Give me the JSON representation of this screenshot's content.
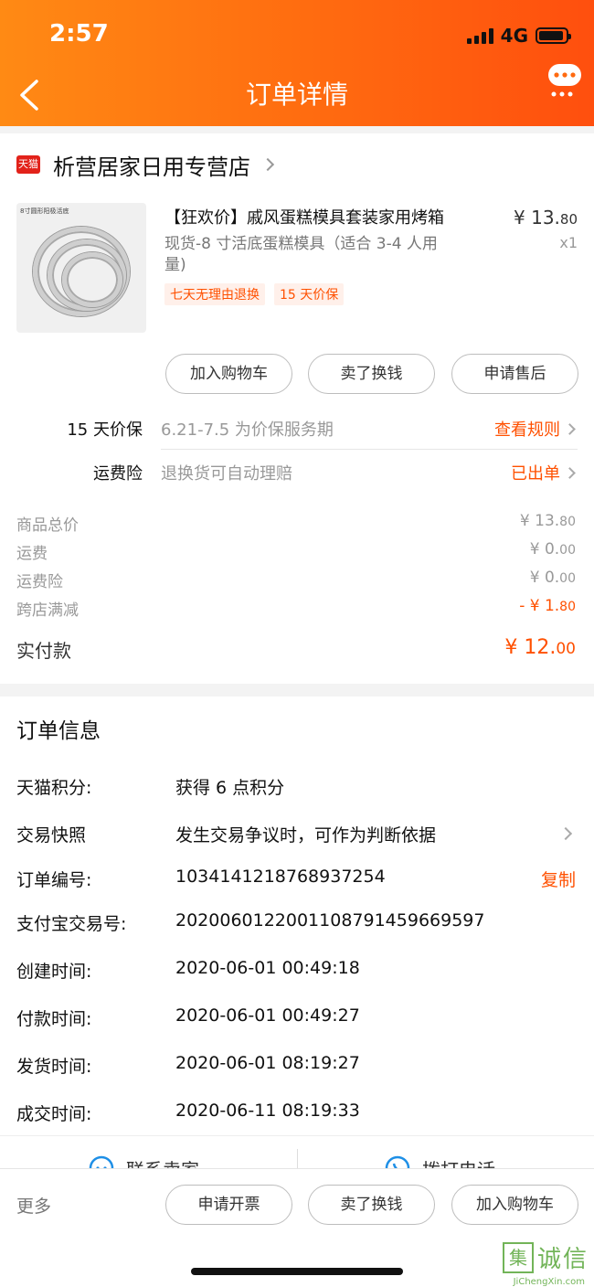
{
  "status_bar": {
    "time": "2:57",
    "network": "4G"
  },
  "header": {
    "title": "订单详情"
  },
  "shop": {
    "badge": "天猫",
    "name": "析营居家日用专营店"
  },
  "product": {
    "image_caption": "8寸圆形阳极活底",
    "title": "【狂欢价】戚风蛋糕模具套装家用烤箱",
    "spec": "现货-8 寸活底蛋糕模具（适合 3-4 人用量)",
    "price_main": "¥ 13.",
    "price_dec": "80",
    "qty": "x1",
    "tags": [
      "七天无理由退换",
      "15 天价保"
    ]
  },
  "item_actions": [
    "加入购物车",
    "卖了换钱",
    "申请售后"
  ],
  "services": [
    {
      "label": "15 天价保",
      "desc": "6.21-7.5 为价保服务期",
      "link": "查看规则"
    },
    {
      "label": "运费险",
      "desc": "退换货可自动理赔",
      "link": "已出单"
    }
  ],
  "fees": [
    {
      "label": "商品总价",
      "main": "¥ 13.",
      "dec": "80"
    },
    {
      "label": "运费",
      "main": "¥ 0.",
      "dec": "00"
    },
    {
      "label": "运费险",
      "main": "¥ 0.",
      "dec": "00"
    },
    {
      "label": "跨店满减",
      "main": "- ¥ 1.",
      "dec": "80"
    }
  ],
  "paid": {
    "label": "实付款",
    "main": "¥ 12.",
    "dec": "00"
  },
  "order_info": {
    "title": "订单信息",
    "rows": [
      {
        "key": "天猫积分:",
        "value": "获得 6 点积分"
      },
      {
        "key": "交易快照",
        "value": "发生交易争议时，可作为判断依据"
      },
      {
        "key": "订单编号:",
        "value": "1034141218768937254",
        "action": "复制"
      },
      {
        "key": "支付宝交易号:",
        "value": "2020060122001108791459669597"
      },
      {
        "key": "创建时间:",
        "value": "2020-06-01 00:49:18"
      },
      {
        "key": "付款时间:",
        "value": "2020-06-01 00:49:27"
      },
      {
        "key": "发货时间:",
        "value": "2020-06-01 08:19:27"
      },
      {
        "key": "成交时间:",
        "value": "2020-06-11 08:19:33"
      }
    ]
  },
  "contact": {
    "seller": "联系卖家",
    "phone": "拨打电话"
  },
  "bottom_bar": {
    "more": "更多",
    "buttons": [
      "申请开票",
      "卖了换钱",
      "加入购物车"
    ]
  },
  "watermark": {
    "cn": "诚信",
    "logo": "集",
    "en": "JiChengXin.com"
  },
  "colors": {
    "accent": "#ff5000",
    "header_start": "#ff8a14",
    "header_end": "#ff4f0e"
  }
}
